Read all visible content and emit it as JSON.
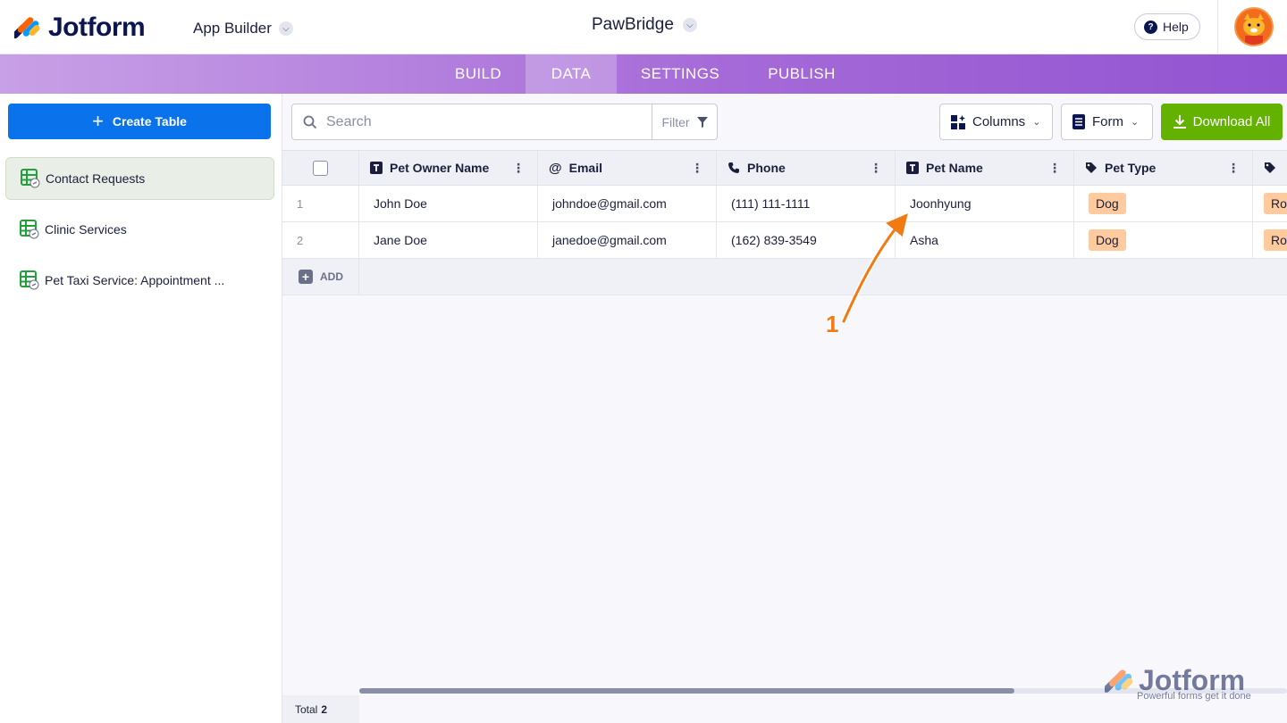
{
  "header": {
    "brand": "Jotform",
    "builder_label": "App Builder",
    "app_name": "PawBridge",
    "help_label": "Help"
  },
  "tabs": [
    {
      "label": "BUILD",
      "active": false
    },
    {
      "label": "DATA",
      "active": true
    },
    {
      "label": "SETTINGS",
      "active": false
    },
    {
      "label": "PUBLISH",
      "active": false
    }
  ],
  "sidebar": {
    "create_label": "Create Table",
    "items": [
      {
        "label": "Contact Requests",
        "active": true
      },
      {
        "label": "Clinic Services",
        "active": false
      },
      {
        "label": "Pet Taxi Service: Appointment ...",
        "active": false
      }
    ]
  },
  "toolbar": {
    "search_placeholder": "Search",
    "filter_label": "Filter",
    "columns_label": "Columns",
    "form_label": "Form",
    "download_label": "Download All"
  },
  "table": {
    "columns": [
      {
        "label": "Pet Owner Name",
        "icon": "text-type-icon"
      },
      {
        "label": "Email",
        "icon": "at-icon"
      },
      {
        "label": "Phone",
        "icon": "phone-icon"
      },
      {
        "label": "Pet Name",
        "icon": "text-type-icon"
      },
      {
        "label": "Pet Type",
        "icon": "tag-icon"
      },
      {
        "label": "",
        "icon": "tag-icon"
      }
    ],
    "rows": [
      {
        "num": "1",
        "owner": "John Doe",
        "email": "johndoe@gmail.com",
        "phone": "(111) 111-1111",
        "pet_name": "Joonhyung",
        "pet_type": "Dog",
        "extra": "Ro"
      },
      {
        "num": "2",
        "owner": "Jane Doe",
        "email": "janedoe@gmail.com",
        "phone": "(162) 839-3549",
        "pet_name": "Asha",
        "pet_type": "Dog",
        "extra": "Ro"
      }
    ],
    "add_label": "ADD"
  },
  "footer": {
    "total_label": "Total",
    "total_count": "2"
  },
  "watermark": {
    "brand": "Jotform",
    "tagline": "Powerful forms get it done"
  },
  "annotation": {
    "number": "1"
  },
  "colors": {
    "primary_blue": "#0a73eb",
    "download_green": "#64b200",
    "tab_purple": "#a66bd8",
    "badge_orange": "#ffcb9e",
    "annotation_orange": "#ef7a1a"
  }
}
